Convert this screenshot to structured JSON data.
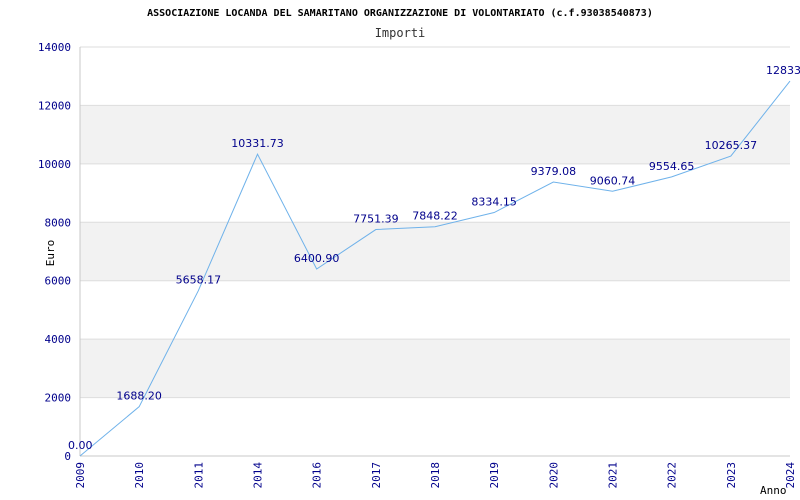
{
  "chart_data": {
    "type": "line",
    "title": "ASSOCIAZIONE LOCANDA DEL SAMARITANO ORGANIZZAZIONE DI VOLONTARIATO (c.f.93038540873)",
    "subtitle": "Importi",
    "xlabel": "Anno",
    "ylabel": "Euro",
    "ylim": [
      0,
      14000
    ],
    "y_ticks": [
      0,
      2000,
      4000,
      6000,
      8000,
      10000,
      12000,
      14000
    ],
    "grid": "horizontal alternating bands",
    "categories": [
      "2009",
      "2010",
      "2011",
      "2014",
      "2016",
      "2017",
      "2018",
      "2019",
      "2020",
      "2021",
      "2022",
      "2023",
      "2024"
    ],
    "series": [
      {
        "values": [
          0.0,
          1688.2,
          5658.17,
          10331.73,
          6400.9,
          7751.39,
          7848.22,
          8334.15,
          9379.08,
          9060.74,
          9554.65,
          10265.37,
          12833
        ],
        "labels": [
          "0.00",
          "1688.20",
          "5658.17",
          "10331.73",
          "6400.90",
          "7751.39",
          "7848.22",
          "8334.15",
          "9379.08",
          "9060.74",
          "9554.65",
          "10265.37",
          "12833."
        ]
      }
    ],
    "colors": {
      "line": "#6fb2ea",
      "band": "#f2f2f2",
      "grid": "#dddddd",
      "axis": "#c8c8c8",
      "tick_text": "#00008b",
      "data_label": "#00008b"
    }
  }
}
